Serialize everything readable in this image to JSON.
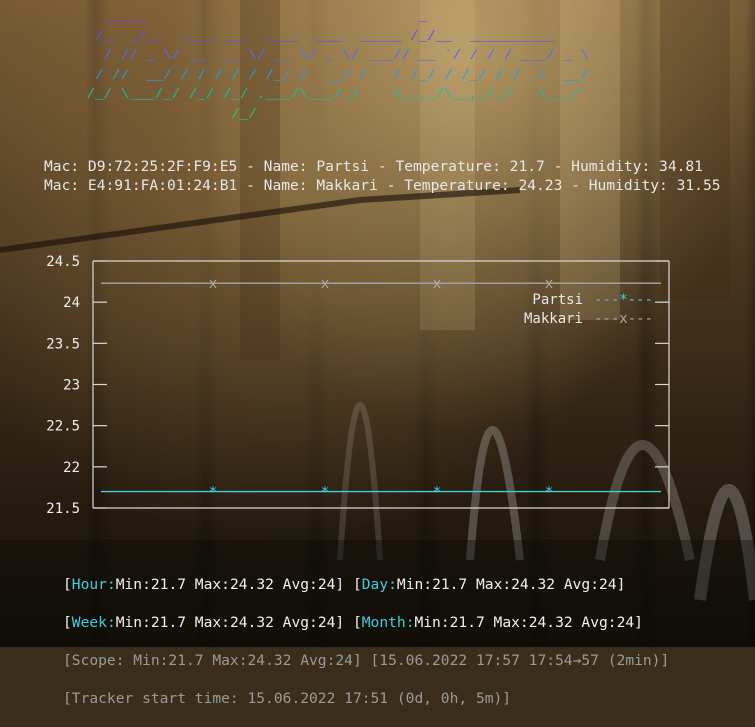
{
  "banner": {
    "lines": [
      "   _____                                _   ",
      "  /_  _/__  ____ ___  ____  ___  _____ /_/__  __________ ",
      "   / // _ \\/ __ `__ \\/ __ \\/ _ \\/ ___// __ `/ / / / ___/ _ \\",
      "  / //  __/ / / / / / /_/ /  __/ /   / /_/ / /_/ / /  /  __/",
      " /_/ \\___/_/ /_/ /_/ .___/\\___/_/    \\__,_/\\__,_/_/   \\___/ ",
      "                  /_/"
    ],
    "colors": [
      "#7b3cf0",
      "#5a5cf2",
      "#2f8fe8",
      "#1fb0b8",
      "#1ec97a"
    ]
  },
  "devices": [
    "Mac: D9:72:25:2F:F9:E5 - Name: Partsi - Temperature: 21.7 - Humidity: 34.81",
    "Mac: E4:91:FA:01:24:B1 - Name: Makkari - Temperature: 24.23 - Humidity: 31.55"
  ],
  "chart_data": {
    "type": "line",
    "ylim": [
      21.5,
      24.5
    ],
    "yticks": [
      "24.5",
      "24",
      "23.5",
      "23",
      "22.5",
      "22",
      "21.5"
    ],
    "legend_position": "top-right",
    "series": [
      {
        "name": "Partsi",
        "marker": "*",
        "color": "#3fd0dc",
        "values": [
          21.7,
          21.7,
          21.7,
          21.7,
          21.7,
          21.7
        ],
        "legend": "---*---"
      },
      {
        "name": "Makkari",
        "marker": "x",
        "color": "#a8a8a8",
        "values": [
          24.23,
          24.23,
          24.23,
          24.23,
          24.23,
          24.23
        ],
        "legend": "---x---"
      }
    ]
  },
  "stats": {
    "hour_label": "Hour:",
    "hour_values": "Min:21.7 Max:24.32 Avg:24]",
    "day_label": "Day:",
    "day_values": "Min:21.7 Max:24.32 Avg:24]",
    "week_label": "Week:",
    "week_values": "Min:21.7 Max:24.32 Avg:24]",
    "month_label": "Month:",
    "month_values": "Min:21.7 Max:24.32 Avg:24]",
    "scope_line": "[Scope: Min:21.7 Max:24.32 Avg:24] [15.06.2022 17:57 17:54→57 (2min)]",
    "tracker_line": "[Tracker start time: 15.06.2022 17:51 (0d, 0h, 5m)]"
  }
}
